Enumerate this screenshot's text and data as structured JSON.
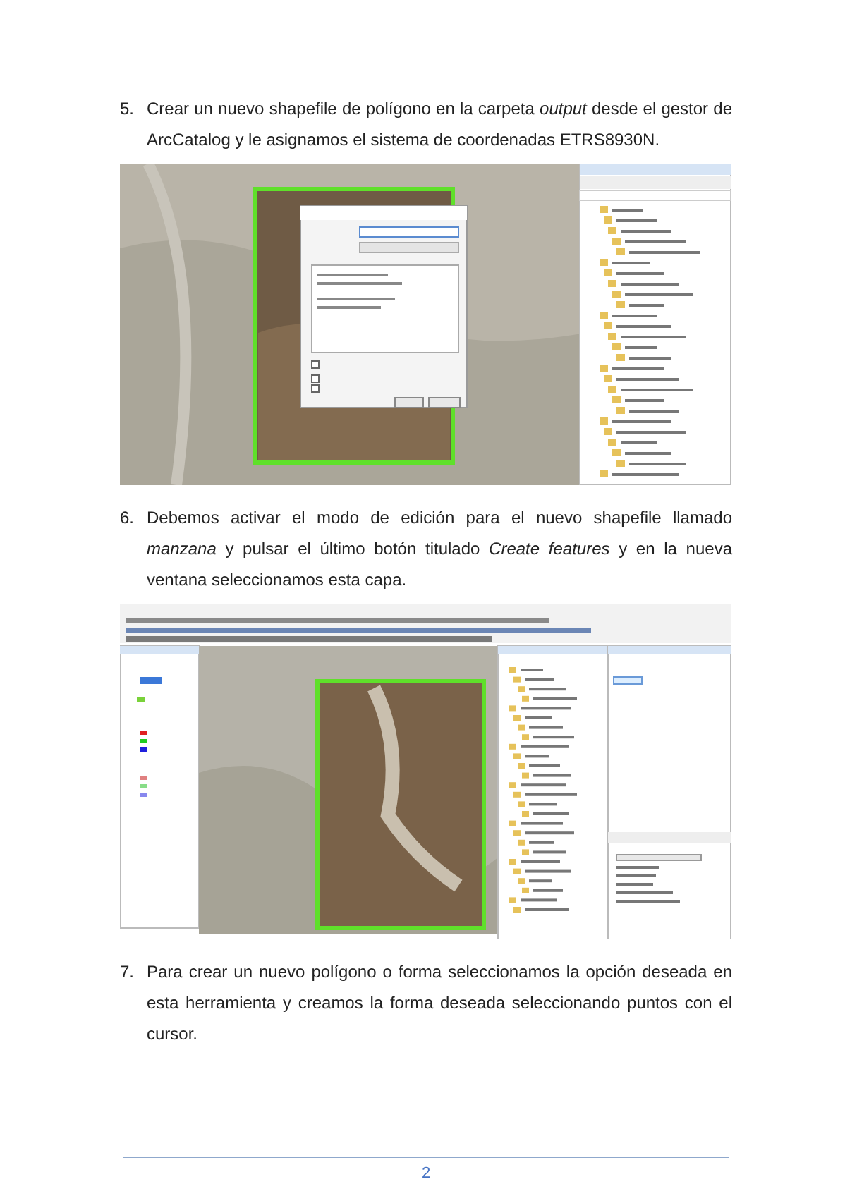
{
  "steps": [
    {
      "number": "5.",
      "text": "Crear un nuevo shapefile de polígono en la carpeta *output* desde el gestor de ArcCatalog y le asignamos el sistema de coordenadas ETRS8930N.",
      "screenshot": {
        "kind": "catalog-dialog"
      }
    },
    {
      "number": "6.",
      "text": "Debemos activar el modo de edición para el nuevo shapefile llamado *manzana* y pulsar el último botón titulado *Create features* y en la nueva ventana seleccionamos esta capa.",
      "screenshot": {
        "kind": "editing-session"
      }
    },
    {
      "number": "7.",
      "text": "Para crear un nuevo polígono o forma seleccionamos la opción deseada en esta herramienta y creamos la forma deseada seleccionando puntos con el cursor."
    }
  ],
  "footer": {
    "page_number": "2"
  }
}
